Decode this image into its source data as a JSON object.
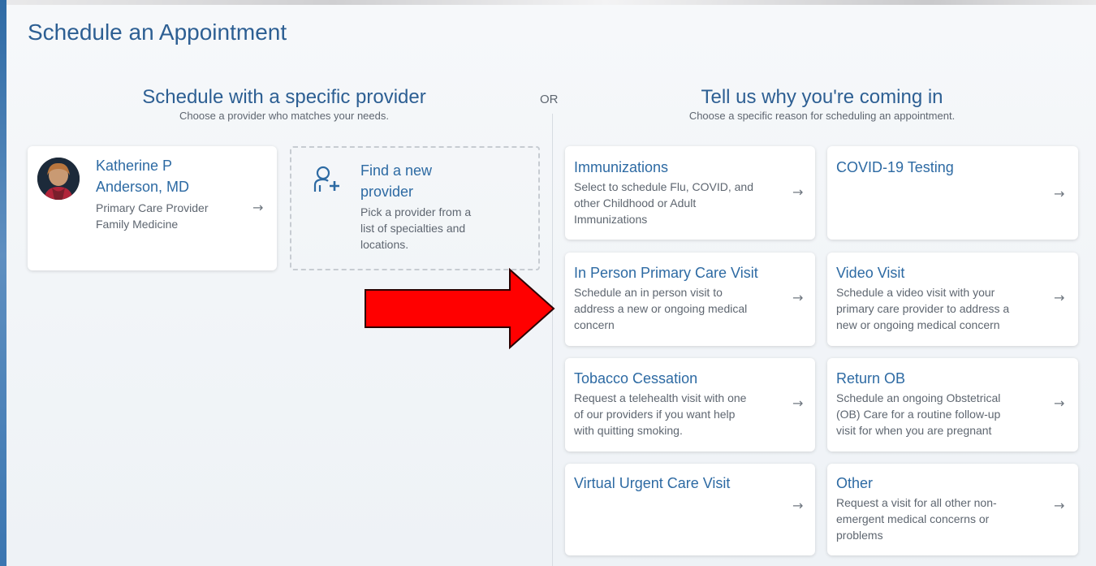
{
  "page": {
    "title": "Schedule an Appointment",
    "or_label": "OR"
  },
  "provider_section": {
    "heading": "Schedule with a specific provider",
    "subheading": "Choose a provider who matches your needs.",
    "provider_card": {
      "name_line1": "Katherine P",
      "name_line2": "Anderson, MD",
      "role": "Primary Care Provider",
      "specialty": "Family Medicine"
    },
    "find_card": {
      "title_line1": "Find a new",
      "title_line2": "provider",
      "desc_line1": "Pick a provider from a",
      "desc_line2": "list of specialties and",
      "desc_line3": "locations."
    }
  },
  "reason_section": {
    "heading": "Tell us why you're coming in",
    "subheading": "Choose a specific reason for scheduling an appointment.",
    "reasons": [
      {
        "title": "Immunizations",
        "desc": [
          "Select to schedule Flu, COVID, and",
          "other Childhood or Adult",
          "Immunizations"
        ]
      },
      {
        "title": "COVID-19 Testing",
        "desc": []
      },
      {
        "title": "In Person Primary Care Visit",
        "desc": [
          "Schedule an in person visit to",
          "address a new or ongoing medical",
          "concern"
        ]
      },
      {
        "title": "Video Visit",
        "desc": [
          "Schedule a video visit with your",
          "primary care provider to address a",
          "new or ongoing medical concern"
        ]
      },
      {
        "title": "Tobacco Cessation",
        "desc": [
          "Request a telehealth visit with one",
          "of our providers if you want help",
          "with quitting smoking."
        ]
      },
      {
        "title": "Return OB",
        "desc": [
          "Schedule an ongoing Obstetrical",
          "(OB) Care for a routine follow-up",
          "visit for when you are pregnant"
        ]
      },
      {
        "title": "Virtual Urgent Care Visit",
        "desc": []
      },
      {
        "title": "Other",
        "desc": [
          "Request a visit for all other non-",
          "emergent medical concerns or",
          "problems"
        ]
      }
    ]
  },
  "icons": {
    "arrow": "→",
    "arrow_name": "right-arrow-icon",
    "find_provider_icon": "person-plus-icon",
    "highlight_arrow": "red-highlight-arrow"
  },
  "colors": {
    "title": "#2d5f93",
    "link": "#2d6aa3",
    "highlight": "#ff0000"
  }
}
